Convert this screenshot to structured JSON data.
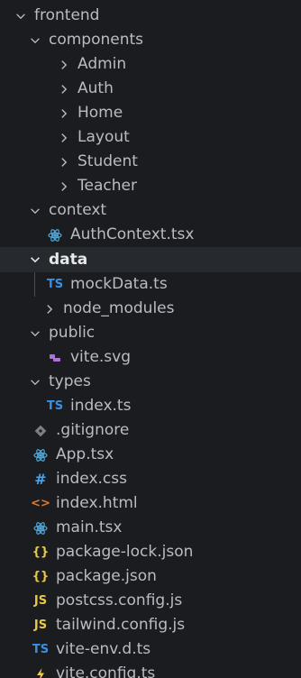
{
  "tree": {
    "frontend": "frontend",
    "components": "components",
    "admin": "Admin",
    "auth": "Auth",
    "home": "Home",
    "layout": "Layout",
    "student": "Student",
    "teacher": "Teacher",
    "context": "context",
    "auth_context": "AuthContext.tsx",
    "data": "data",
    "mock_data": "mockData.ts",
    "node_modules": "node_modules",
    "public": "public",
    "vite_svg": "vite.svg",
    "types": "types",
    "index_ts": "index.ts",
    "gitignore": ".gitignore",
    "app_tsx": "App.tsx",
    "index_css": "index.css",
    "index_html": "index.html",
    "main_tsx": "main.tsx",
    "package_lock": "package-lock.json",
    "package_json": "package.json",
    "postcss": "postcss.config.js",
    "tailwind": "tailwind.config.js",
    "vite_env": "vite-env.d.ts",
    "vite_config": "vite.config.ts"
  },
  "icons": {
    "ts_glyph": "TS",
    "js_glyph": "JS",
    "css_glyph": "#",
    "html_glyph": "<>",
    "json_glyph": "{}"
  },
  "colors": {
    "background": "#1a1c1f",
    "selected_row": "#26292e",
    "ts": "#3c8fe0",
    "react": "#4fa7d6",
    "json": "#e6c84a",
    "js": "#e6c84a",
    "html": "#e37933",
    "css": "#42a5f5",
    "svg": "#b06fe0",
    "git": "#7a7f88",
    "vite": "#f2c94c"
  }
}
